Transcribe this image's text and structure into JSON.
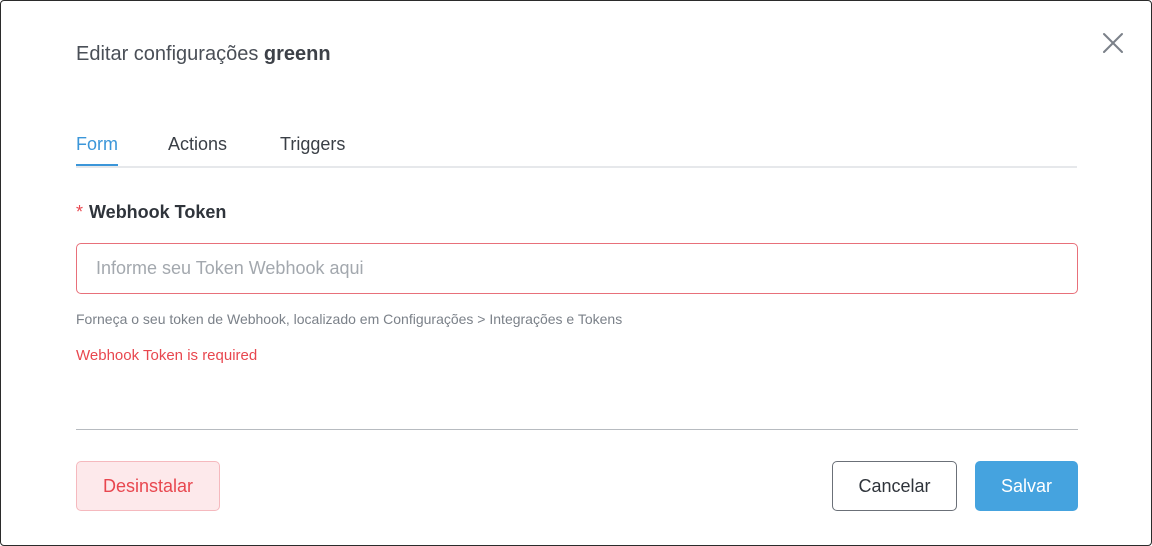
{
  "dialog": {
    "title_prefix": "Editar configurações",
    "app_name": "greenn",
    "close_icon": "close-icon"
  },
  "tabs": [
    {
      "label": "Form",
      "active": true
    },
    {
      "label": "Actions",
      "active": false
    },
    {
      "label": "Triggers",
      "active": false
    }
  ],
  "form": {
    "field_label": "Webhook Token",
    "required_marker": "*",
    "input_value": "",
    "input_placeholder": "Informe seu Token Webhook aqui",
    "hint": "Forneça o seu token de Webhook, localizado em Configurações > Integrações e Tokens",
    "error": "Webhook Token is required"
  },
  "footer": {
    "uninstall_label": "Desinstalar",
    "cancel_label": "Cancelar",
    "save_label": "Salvar"
  },
  "colors": {
    "accent": "#3b96d9",
    "save_button": "#45a3df",
    "error": "#e8474f",
    "uninstall_bg": "#fde9eb"
  }
}
